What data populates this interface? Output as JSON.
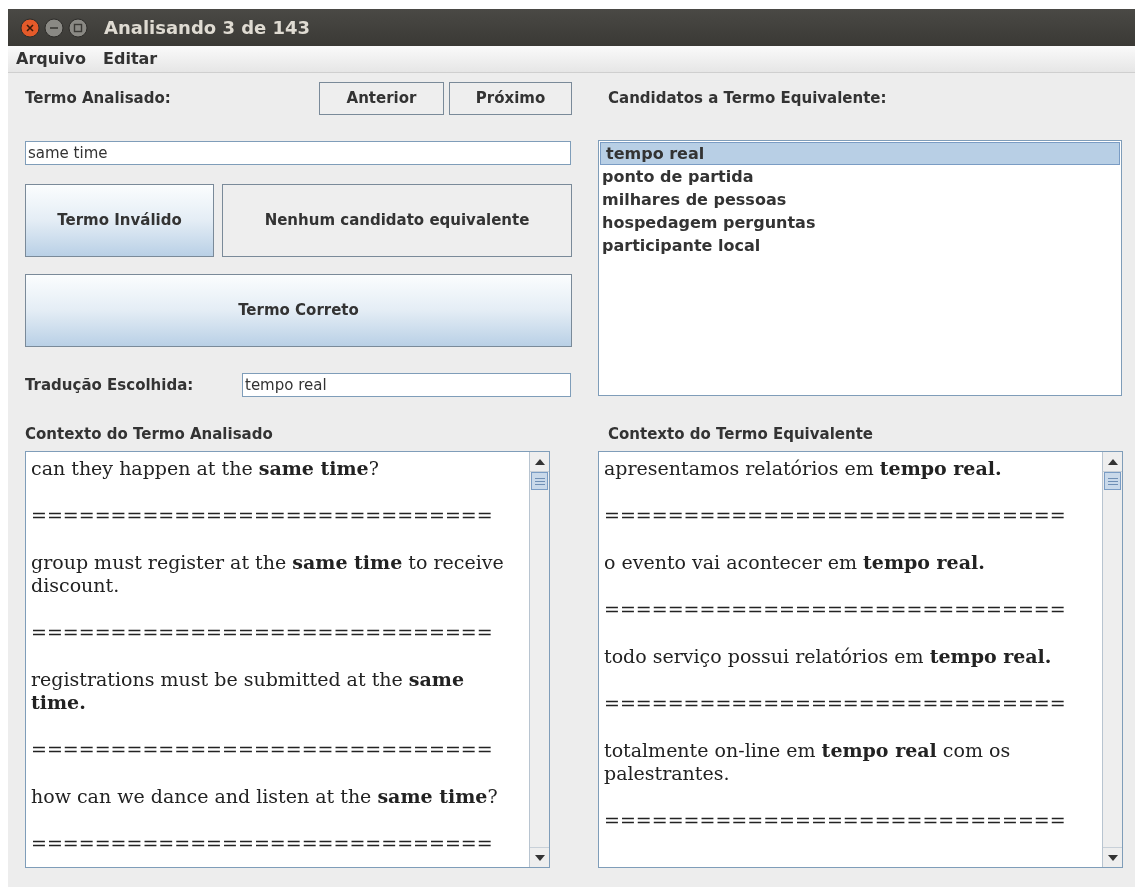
{
  "window": {
    "title": "Analisando 3 de 143"
  },
  "menu": [
    "Arquivo",
    "Editar"
  ],
  "analyzed_term": {
    "label": "Termo Analisado:",
    "value": "same time"
  },
  "nav_buttons": [
    "Anterior",
    "Próximo"
  ],
  "action_buttons": [
    {
      "label": "Termo Inválido",
      "kind": "highlighted"
    },
    {
      "label": "Nenhum candidato equivalente",
      "kind": "plain"
    },
    {
      "label": "Termo Correto",
      "kind": "highlighted"
    }
  ],
  "chosen_translation": {
    "label": "Tradução Escolhida:",
    "value": "tempo real"
  },
  "candidates": {
    "label": "Candidatos a Termo Equivalente:",
    "items": [
      {
        "text": "tempo real",
        "selected": true
      },
      {
        "text": "ponto de partida",
        "selected": false
      },
      {
        "text": "milhares de pessoas",
        "selected": false
      },
      {
        "text": "hospedagem perguntas",
        "selected": false
      },
      {
        "text": "participante local",
        "selected": false
      }
    ]
  },
  "contexts": [
    {
      "label": "Contexto do Termo Analisado",
      "lines": [
        "can they happen at the **same time**?",
        "=============================",
        "group must register at the **same time** to receive discount.",
        "=============================",
        "registrations must be submitted at the **same time.**",
        "=============================",
        "how can we dance and listen at the **same time**?",
        "============================="
      ]
    },
    {
      "label": "Contexto do Termo Equivalente",
      "lines": [
        "apresentamos relatórios em **tempo real.**",
        "=============================",
        "o evento vai acontecer em **tempo real.**",
        "=============================",
        "todo serviço possui relatórios em **tempo real.**",
        "=============================",
        "totalmente on-line em **tempo real** com os palestrantes.",
        "============================="
      ]
    }
  ]
}
